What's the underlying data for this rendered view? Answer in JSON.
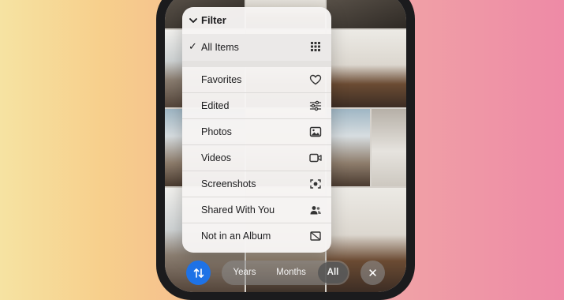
{
  "filter_menu": {
    "title": "Filter",
    "items": [
      {
        "label": "All Items",
        "icon": "grid-icon",
        "selected": true
      },
      {
        "label": "Favorites",
        "icon": "heart-icon",
        "selected": false
      },
      {
        "label": "Edited",
        "icon": "sliders-icon",
        "selected": false
      },
      {
        "label": "Photos",
        "icon": "photo-icon",
        "selected": false
      },
      {
        "label": "Videos",
        "icon": "video-camera-icon",
        "selected": false
      },
      {
        "label": "Screenshots",
        "icon": "screenshot-icon",
        "selected": false
      },
      {
        "label": "Shared With You",
        "icon": "shared-people-icon",
        "selected": false
      },
      {
        "label": "Not in an Album",
        "icon": "no-album-icon",
        "selected": false
      }
    ],
    "checkmark": "✓"
  },
  "bottom_bar": {
    "segments": [
      "Years",
      "Months",
      "All"
    ],
    "active_segment": "All",
    "close_symbol": "✕"
  },
  "colors": {
    "accent": "#1e72e6"
  }
}
